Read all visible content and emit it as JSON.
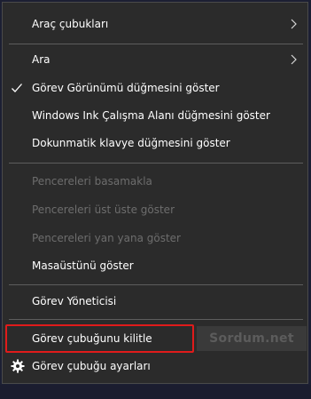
{
  "menu": {
    "toolbars": "Araç çubukları",
    "search": "Ara",
    "show_task_view": "Görev Görünümü düğmesini göster",
    "show_ink_workspace": "Windows Ink Çalışma Alanı düğmesini göster",
    "show_touch_keyboard": "Dokunmatik klavye düğmesini göster",
    "cascade_windows": "Pencereleri basamakla",
    "stack_windows": "Pencereleri üst üste göster",
    "side_by_side": "Pencereleri yan yana göster",
    "show_desktop": "Masaüstünü göster",
    "task_manager": "Görev Yöneticisi",
    "lock_taskbar": "Görev çubuğunu kilitle",
    "taskbar_settings": "Görev çubuğu ayarları"
  },
  "watermark": "Sordum.net",
  "colors": {
    "menu_bg": "#2b2b2b",
    "text": "#ffffff",
    "disabled_text": "#6d6d6d",
    "separator": "#5d5d5d",
    "highlight": "#e01b1b"
  },
  "icons": {
    "submenu": "chevron-right-icon",
    "checked": "checkmark-icon",
    "settings": "gear-icon"
  }
}
